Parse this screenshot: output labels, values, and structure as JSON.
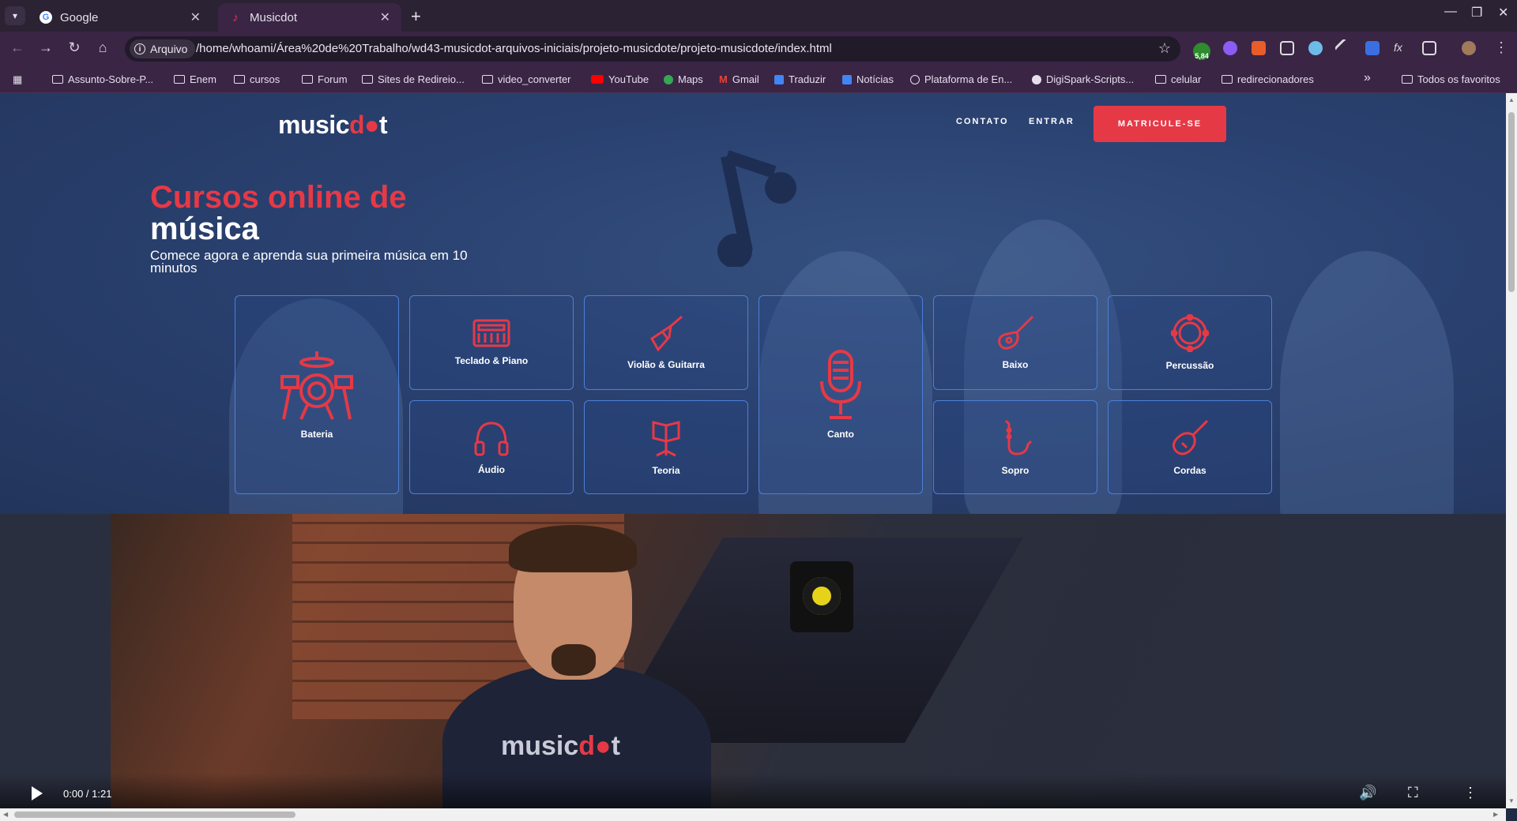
{
  "browser": {
    "tabs": [
      {
        "title": "Google",
        "favicon": "google-icon"
      },
      {
        "title": "Musicdot",
        "favicon": "musicdot-icon"
      }
    ],
    "address": {
      "scheme_chip": "Arquivo",
      "url": "/home/whoami/Área%20de%20Trabalho/wd43-musicdot-arquivos-iniciais/projeto-musicdote/projeto-musicdote/index.html"
    },
    "extension_badge": "5,84",
    "bookmarks": [
      {
        "label": "Assunto-Sobre-P...",
        "icon": "folder-icon"
      },
      {
        "label": "Enem",
        "icon": "folder-icon"
      },
      {
        "label": "cursos",
        "icon": "folder-icon"
      },
      {
        "label": "Forum",
        "icon": "folder-icon"
      },
      {
        "label": "Sites de Redireio...",
        "icon": "folder-icon"
      },
      {
        "label": "video_converter",
        "icon": "folder-icon"
      },
      {
        "label": "YouTube",
        "icon": "youtube-icon"
      },
      {
        "label": "Maps",
        "icon": "maps-icon"
      },
      {
        "label": "Gmail",
        "icon": "gmail-icon"
      },
      {
        "label": "Traduzir",
        "icon": "translate-icon"
      },
      {
        "label": "Notícias",
        "icon": "news-icon"
      },
      {
        "label": "Plataforma de En...",
        "icon": "globe-icon"
      },
      {
        "label": "DigiSpark-Scripts...",
        "icon": "github-icon"
      },
      {
        "label": "celular",
        "icon": "folder-icon"
      },
      {
        "label": "redirecionadores",
        "icon": "folder-icon"
      }
    ],
    "bookmarks_overflow": "»",
    "all_bookmarks": "Todos os favoritos"
  },
  "site": {
    "logo": {
      "part1": "music",
      "accent": "d",
      "part2": "t"
    },
    "nav": {
      "contact": "CONTATO",
      "login": "ENTRAR",
      "cta": "MATRICULE-SE"
    },
    "hero": {
      "headline_red": "Cursos online de",
      "headline_white": "música",
      "subtitle": "Comece agora e aprenda sua primeira música em 10 minutos"
    },
    "courses": [
      {
        "label": "Bateria",
        "icon": "drums-icon"
      },
      {
        "label": "Teclado & Piano",
        "icon": "keyboard-icon"
      },
      {
        "label": "Violão & Guitarra",
        "icon": "guitar-icon"
      },
      {
        "label": "Canto",
        "icon": "microphone-icon"
      },
      {
        "label": "Baixo",
        "icon": "bass-icon"
      },
      {
        "label": "Percussão",
        "icon": "tambourine-icon"
      },
      {
        "label": "Áudio",
        "icon": "headphones-icon"
      },
      {
        "label": "Teoria",
        "icon": "music-stand-icon"
      },
      {
        "label": "Sopro",
        "icon": "saxophone-icon"
      },
      {
        "label": "Cordas",
        "icon": "violin-icon"
      }
    ],
    "video": {
      "time": "0:00 / 1:21",
      "shirt_logo": {
        "part1": "music",
        "accent": "d",
        "part2": "t"
      }
    }
  },
  "colors": {
    "accent": "#e63946",
    "card_border": "#4c7fd8",
    "hero_bg": "#2a4170"
  }
}
